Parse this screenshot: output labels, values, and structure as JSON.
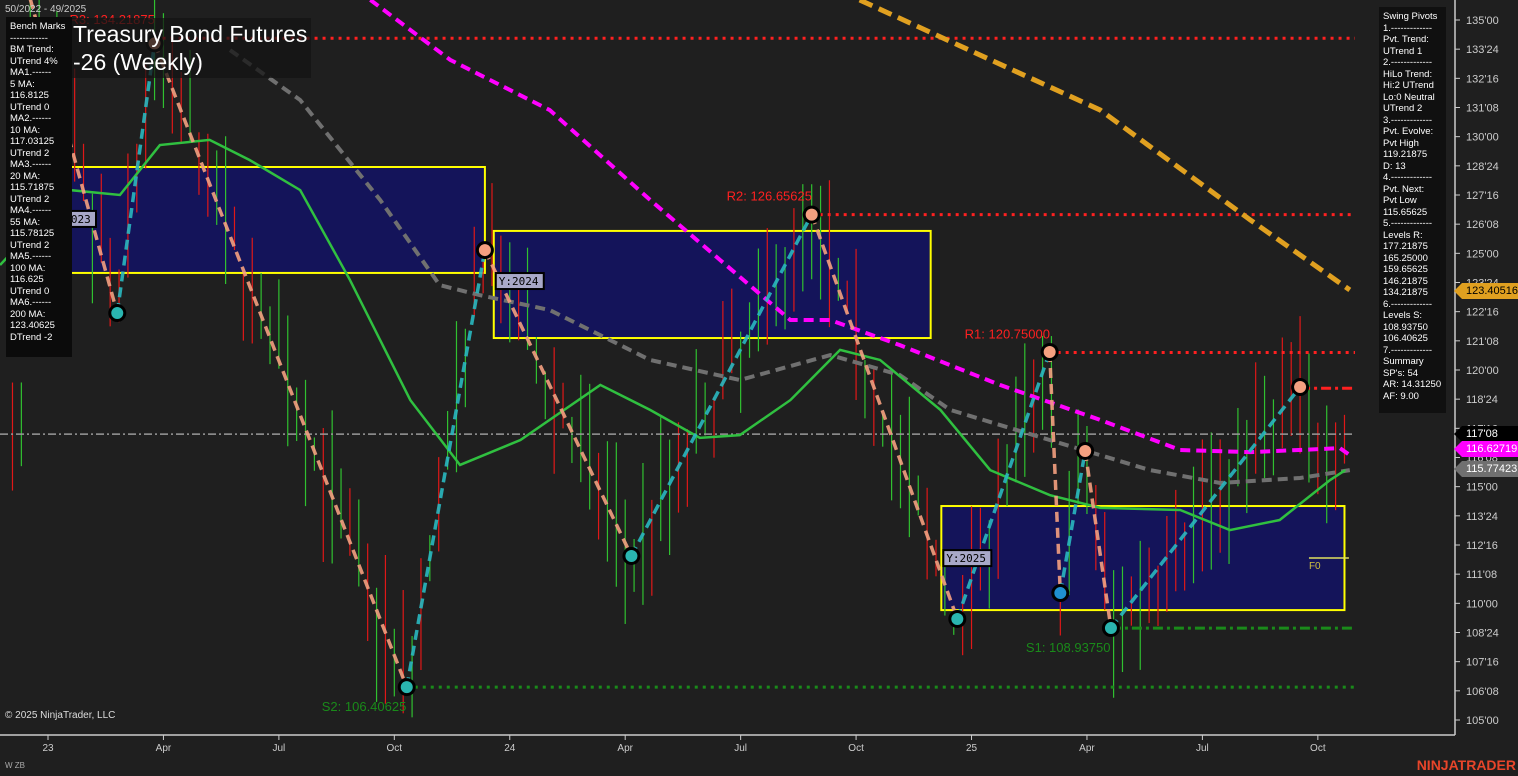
{
  "header": {
    "date_range": "50/2022 - 49/2025",
    "title_line1": "Treasury Bond Futures",
    "title_line2": "-26 (Weekly)"
  },
  "bench_marks": [
    "Bench Marks",
    "------------",
    "BM Trend:",
    "UTrend 4%",
    "MA1.------",
    "5 MA:",
    "116.8125",
    "UTrend 0",
    "MA2.------",
    "10 MA:",
    "117.03125",
    "UTrend 2",
    "MA3.------",
    "20 MA:",
    "115.71875",
    "UTrend 2",
    "MA4.------",
    "55 MA:",
    "115.78125",
    "UTrend 2",
    "MA5.------",
    "100 MA:",
    "116.625",
    "UTrend 0",
    "MA6.------",
    "200 MA:",
    "123.40625",
    "DTrend -2"
  ],
  "swing_pivots": [
    "Swing Pivots",
    "1.-------------",
    "Pvt. Trend:",
    "UTrend 1",
    "2.-------------",
    "HiLo Trend:",
    "Hi:2 UTrend",
    "Lo:0 Neutral",
    "UTrend 2",
    "3.-------------",
    "Pvt. Evolve:",
    "Pvt High",
    "119.21875",
    "D: 13",
    "4.-------------",
    "Pvt. Next:",
    "Pvt Low",
    "115.65625",
    "5.-------------",
    "Levels R:",
    "177.21875",
    "165.25000",
    "159.65625",
    "146.21875",
    "134.21875",
    "6.-------------",
    "Levels S:",
    "108.93750",
    "106.40625",
    "7.-------------",
    "Summary",
    "SP's: 54",
    "AR: 14.31250",
    "AF: 9.00"
  ],
  "footer": {
    "copyright": "© 2025 NinjaTrader, LLC",
    "symbol": "W ZB",
    "brand": "NINJATRADER"
  },
  "price_tags": [
    {
      "label": "123.40516",
      "value": 123.40516,
      "bg": "#e0a020",
      "fg": "#000"
    },
    {
      "label": "117'08",
      "value": 117.25,
      "bg": "#000000",
      "fg": "#fff"
    },
    {
      "label": "116.62719",
      "value": 116.62719,
      "bg": "#ff00ff",
      "fg": "#fff"
    },
    {
      "label": "115.77423",
      "value": 115.77423,
      "bg": "#707070",
      "fg": "#fff"
    }
  ],
  "chart_data": {
    "type": "line",
    "title": "Treasury Bond Futures (Weekly)",
    "ylim": [
      105,
      135
    ],
    "xlim_weeks": [
      -5.4,
      158
    ],
    "y_ticks": [
      {
        "v": 135,
        "l": "135'00"
      },
      {
        "v": 133.75,
        "l": "133'24"
      },
      {
        "v": 132.5,
        "l": "132'16"
      },
      {
        "v": 131.25,
        "l": "131'08"
      },
      {
        "v": 130,
        "l": "130'00"
      },
      {
        "v": 128.75,
        "l": "128'24"
      },
      {
        "v": 127.5,
        "l": "127'16"
      },
      {
        "v": 126.25,
        "l": "126'08"
      },
      {
        "v": 125,
        "l": "125'00"
      },
      {
        "v": 123.75,
        "l": "123'24"
      },
      {
        "v": 122.5,
        "l": "122'16"
      },
      {
        "v": 121.25,
        "l": "121'08"
      },
      {
        "v": 120,
        "l": "120'00"
      },
      {
        "v": 118.75,
        "l": "118'24"
      },
      {
        "v": 117.5,
        "l": "117'16"
      },
      {
        "v": 116.25,
        "l": "116'08"
      },
      {
        "v": 115,
        "l": "115'00"
      },
      {
        "v": 113.75,
        "l": "113'24"
      },
      {
        "v": 112.5,
        "l": "112'16"
      },
      {
        "v": 111.25,
        "l": "111'08"
      },
      {
        "v": 110,
        "l": "110'00"
      },
      {
        "v": 108.75,
        "l": "108'24"
      },
      {
        "v": 107.5,
        "l": "107'16"
      },
      {
        "v": 106.25,
        "l": "106'08"
      },
      {
        "v": 105,
        "l": "105'00"
      }
    ],
    "x_ticks": [
      {
        "w": 0,
        "l": "23"
      },
      {
        "w": 13,
        "l": "Apr"
      },
      {
        "w": 26,
        "l": "Jul"
      },
      {
        "w": 39,
        "l": "Oct"
      },
      {
        "w": 52,
        "l": "24"
      },
      {
        "w": 65,
        "l": "Apr"
      },
      {
        "w": 78,
        "l": "Jul"
      },
      {
        "w": 91,
        "l": "Oct"
      },
      {
        "w": 104,
        "l": "25"
      },
      {
        "w": 117,
        "l": "Apr"
      },
      {
        "w": 130,
        "l": "Jul"
      },
      {
        "w": 143,
        "l": "Oct"
      }
    ],
    "year_boxes": [
      {
        "label": "Y:2023",
        "w0": 0,
        "w1": 49.2,
        "hi": 128.7,
        "lo": 124.16
      },
      {
        "label": "Y:2024",
        "w0": 50.2,
        "w1": 99.4,
        "hi": 125.96,
        "lo": 121.37
      },
      {
        "label": "Y:2025",
        "w0": 100.6,
        "w1": 146,
        "hi": 114.17,
        "lo": 109.71
      }
    ],
    "levels": [
      {
        "label": "R3: 134.21875",
        "price": 134.21875,
        "w0": 12,
        "color": "#ff2020",
        "style": "dot"
      },
      {
        "label": "R2: 126.65625",
        "price": 126.65625,
        "w0": 86,
        "color": "#ff2020",
        "style": "dot"
      },
      {
        "label": "R1: 120.75000",
        "price": 120.75,
        "w0": 112.8,
        "color": "#ff2020",
        "style": "dot"
      },
      {
        "label": "",
        "price": 119.21875,
        "w0": 141,
        "color": "#ff2020",
        "style": "dashdot"
      },
      {
        "label": "S1: 108.93750",
        "price": 108.9375,
        "w0": 119.7,
        "color": "#1a8a1a",
        "style": "dashdot"
      },
      {
        "label": "S2: 106.40625",
        "price": 106.40625,
        "w0": 40.4,
        "color": "#1a8a1a",
        "style": "dot"
      }
    ],
    "last_price": 117.25,
    "f0": {
      "label": "F0",
      "price": 111.94,
      "w0": 142,
      "w1": 146.5
    },
    "pivots": [
      {
        "w": -2,
        "p": 135.9,
        "t": "H"
      },
      {
        "w": 7.8,
        "p": 122.44,
        "t": "L"
      },
      {
        "w": 12,
        "p": 134.0,
        "t": "H"
      },
      {
        "w": 40.4,
        "p": 106.41,
        "t": "L"
      },
      {
        "w": 49.2,
        "p": 125.14,
        "t": "H"
      },
      {
        "w": 65.7,
        "p": 112.03,
        "t": "L"
      },
      {
        "w": 86,
        "p": 126.66,
        "t": "H"
      },
      {
        "w": 102.4,
        "p": 109.33,
        "t": "L"
      },
      {
        "w": 112.8,
        "p": 120.77,
        "t": "H"
      },
      {
        "w": 114,
        "p": 110.44,
        "t": "L2"
      },
      {
        "w": 116.8,
        "p": 116.53,
        "t": "H"
      },
      {
        "w": 119.7,
        "p": 108.94,
        "t": "L"
      },
      {
        "w": 141,
        "p": 119.27,
        "t": "H"
      }
    ],
    "series": [
      {
        "name": "MA magenta",
        "color": "#ff00ff",
        "dash": "10 6",
        "width": 4,
        "points": [
          [
            36.3,
            135.86
          ],
          [
            45.3,
            133.29
          ],
          [
            56.5,
            131.14
          ],
          [
            67.8,
            127.29
          ],
          [
            75.7,
            124.71
          ],
          [
            83.6,
            122.14
          ],
          [
            88.1,
            122.14
          ],
          [
            95.9,
            121.07
          ],
          [
            107.2,
            119.36
          ],
          [
            118.5,
            117.86
          ],
          [
            127.5,
            116.57
          ],
          [
            135.4,
            116.48
          ],
          [
            145.5,
            116.65
          ],
          [
            146.6,
            116.35
          ]
        ]
      },
      {
        "name": "MA grey",
        "color": "#707070",
        "dash": "10 6",
        "width": 4,
        "points": [
          [
            20.5,
            133.71
          ],
          [
            28.4,
            131.57
          ],
          [
            37.4,
            127.29
          ],
          [
            44.1,
            123.64
          ],
          [
            48.6,
            123.21
          ],
          [
            56.5,
            122.57
          ],
          [
            67.8,
            120.43
          ],
          [
            77.9,
            119.57
          ],
          [
            88.1,
            120.64
          ],
          [
            95.9,
            119.79
          ],
          [
            101.6,
            118.29
          ],
          [
            112.8,
            117.0
          ],
          [
            124.1,
            115.71
          ],
          [
            132.0,
            115.16
          ],
          [
            141.0,
            115.37
          ],
          [
            146.6,
            115.71
          ]
        ]
      },
      {
        "name": "MA green",
        "color": "#30c040",
        "dash": "",
        "width": 2.5,
        "points": [
          [
            -5.4,
            124.5
          ],
          [
            2.5,
            127.71
          ],
          [
            8.1,
            127.5
          ],
          [
            12.6,
            129.64
          ],
          [
            18.2,
            129.86
          ],
          [
            22.7,
            129.0
          ],
          [
            28.4,
            127.71
          ],
          [
            34.0,
            123.86
          ],
          [
            40.8,
            118.71
          ],
          [
            46.4,
            115.93
          ],
          [
            53.2,
            117.0
          ],
          [
            62.2,
            119.36
          ],
          [
            67.8,
            118.29
          ],
          [
            73.4,
            117.09
          ],
          [
            77.9,
            117.21
          ],
          [
            83.6,
            118.71
          ],
          [
            89.2,
            120.86
          ],
          [
            93.7,
            120.43
          ],
          [
            100.5,
            118.29
          ],
          [
            106.1,
            115.71
          ],
          [
            112.8,
            114.64
          ],
          [
            118.5,
            114.09
          ],
          [
            127.5,
            114.0
          ],
          [
            133.1,
            113.14
          ],
          [
            138.7,
            113.57
          ],
          [
            144.4,
            115.29
          ],
          [
            146.1,
            115.71
          ]
        ]
      },
      {
        "name": "MA orange",
        "color": "#e0a020",
        "dash": "14 7",
        "width": 5,
        "points": [
          [
            91.4,
            135.86
          ],
          [
            118.5,
            131.14
          ],
          [
            135.4,
            126.43
          ],
          [
            146.6,
            123.43
          ]
        ]
      }
    ]
  }
}
